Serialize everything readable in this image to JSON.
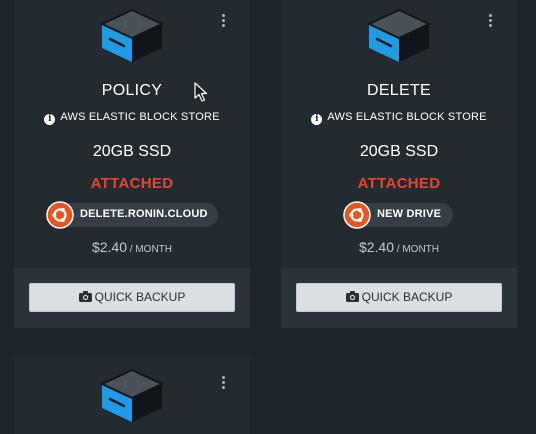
{
  "cards": [
    {
      "name": "POLICY",
      "type": "AWS ELASTIC BLOCK STORE",
      "size": "20GB SSD",
      "status": "ATTACHED",
      "instance": "DELETE.RONIN.CLOUD",
      "price": "$2.40",
      "period": " / MONTH",
      "backup_label": "QUICK BACKUP"
    },
    {
      "name": "DELETE",
      "type": "AWS ELASTIC BLOCK STORE",
      "size": "20GB SSD",
      "status": "ATTACHED",
      "instance": "NEW DRIVE",
      "price": "$2.40",
      "period": " / MONTH",
      "backup_label": "QUICK BACKUP"
    }
  ],
  "info_glyph": "i",
  "icons": {
    "drive": "drive-icon",
    "info": "info-icon",
    "os": "ubuntu-icon",
    "camera": "camera-icon",
    "menu": "kebab-menu-icon"
  },
  "colors": {
    "background": "#1e252b",
    "card": "#232a30",
    "status_attached": "#e8452f",
    "drive_accent": "#1e9be4",
    "ubuntu": "#e95420",
    "button": "#dcdfe2"
  }
}
